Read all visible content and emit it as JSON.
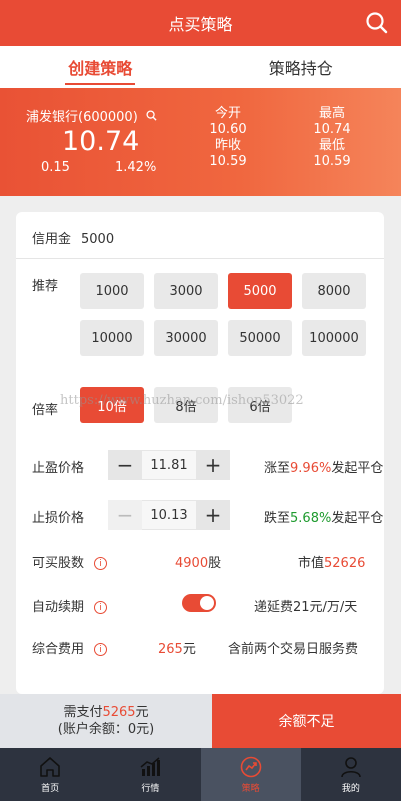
{
  "header": {
    "title": "点买策略",
    "search_icon": "search-icon"
  },
  "tabs": [
    {
      "label": "创建策略",
      "active": true
    },
    {
      "label": "策略持仓",
      "active": false
    }
  ],
  "quote": {
    "stock_name": "浦发银行(600000)",
    "price": "10.74",
    "change": "0.15",
    "change_pct": "1.42%",
    "open_label": "今开",
    "open": "10.60",
    "prev_close_label": "昨收",
    "prev_close": "10.59",
    "high_label": "最高",
    "high": "10.74",
    "low_label": "最低",
    "low": "10.59"
  },
  "credit": {
    "label": "信用金",
    "value": "5000"
  },
  "recommend": {
    "label": "推荐",
    "options": [
      "1000",
      "3000",
      "5000",
      "8000",
      "10000",
      "30000",
      "50000",
      "100000"
    ],
    "selected": "5000"
  },
  "leverage": {
    "label": "倍率",
    "options": [
      "10倍",
      "8倍",
      "6倍"
    ],
    "selected": "10倍"
  },
  "watermark": "https://www.huzhan.com/ishop53022",
  "take_profit": {
    "label": "止盈价格",
    "value": "11.81",
    "hint_prefix": "涨至",
    "hint_pct": "9.96%",
    "hint_suffix": "发起平仓"
  },
  "stop_loss": {
    "label": "止损价格",
    "value": "10.13",
    "hint_prefix": "跌至",
    "hint_pct": "5.68%",
    "hint_suffix": "发起平仓"
  },
  "shares": {
    "label": "可买股数",
    "value": "4900",
    "unit": "股",
    "mv_label": "市值",
    "mv_value": "52626"
  },
  "auto_renew": {
    "label": "自动续期",
    "on": true,
    "fee_text": "递延费21元/万/天"
  },
  "total_fee": {
    "label": "综合费用",
    "value": "265",
    "unit": "元",
    "note": "含前两个交易日服务费"
  },
  "pay": {
    "need_prefix": "需支付",
    "need_amount": "5265",
    "need_unit": "元",
    "balance_text": "(账户余额：0元)",
    "action_label": "余额不足"
  },
  "tabbar": [
    {
      "label": "首页",
      "icon": "home-icon",
      "active": false
    },
    {
      "label": "行情",
      "icon": "chart-icon",
      "active": false
    },
    {
      "label": "策略",
      "icon": "strategy-icon",
      "active": true
    },
    {
      "label": "我的",
      "icon": "user-icon",
      "active": false
    }
  ],
  "colors": {
    "accent": "#e84b35",
    "green": "#1f9b2f",
    "tabbar": "#2d333f"
  }
}
